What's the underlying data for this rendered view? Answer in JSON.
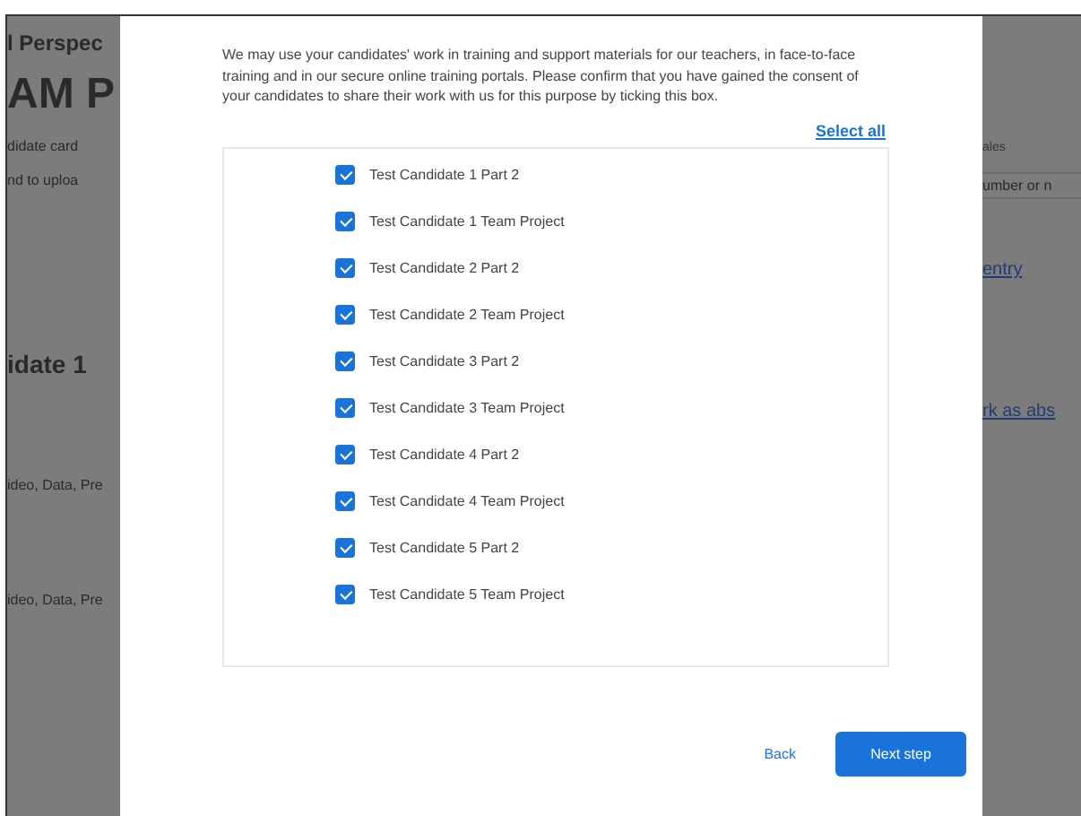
{
  "background": {
    "left": [
      {
        "kind": "subtitle",
        "text": "l Perspec"
      },
      {
        "kind": "title",
        "text": "AM P"
      },
      {
        "kind": "text",
        "text": "didate card"
      },
      {
        "kind": "text",
        "text": "nd to uploa"
      },
      {
        "kind": "heading",
        "text": "idate 1"
      },
      {
        "kind": "text",
        "text": "ideo, Data, Pre"
      },
      {
        "kind": "text",
        "text": "ideo, Data, Pre"
      }
    ],
    "right": [
      {
        "kind": "label",
        "text": "ales"
      },
      {
        "kind": "field",
        "text": "umber or n"
      },
      {
        "kind": "link",
        "text": "entry"
      },
      {
        "kind": "link",
        "text": "rk as abs"
      }
    ]
  },
  "modal": {
    "message": "We may use your candidates' work in training and support materials for our teachers, in face-to-face training and in our secure online training portals. Please confirm that you have gained the consent of your candidates to share their work with us for this purpose by ticking this box.",
    "select_all": "Select all",
    "items": [
      {
        "label": "Test Candidate 1 Part 2",
        "checked": true
      },
      {
        "label": "Test Candidate 1 Team Project",
        "checked": true
      },
      {
        "label": "Test Candidate 2 Part 2",
        "checked": true
      },
      {
        "label": "Test Candidate 2 Team Project",
        "checked": true
      },
      {
        "label": "Test Candidate 3 Part 2",
        "checked": true
      },
      {
        "label": "Test Candidate 3 Team Project",
        "checked": true
      },
      {
        "label": "Test Candidate 4 Part 2",
        "checked": true
      },
      {
        "label": "Test Candidate 4 Team Project",
        "checked": true
      },
      {
        "label": "Test Candidate 5 Part 2",
        "checked": true
      },
      {
        "label": "Test Candidate 5 Team Project",
        "checked": true
      }
    ],
    "back": "Back",
    "next": "Next step"
  }
}
